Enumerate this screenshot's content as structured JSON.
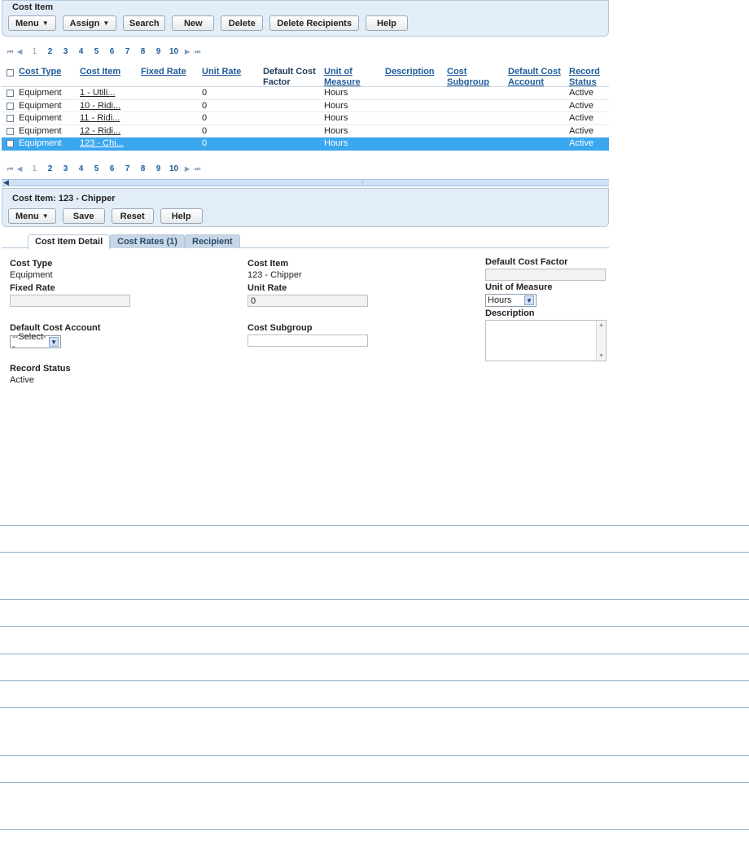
{
  "list_panel": {
    "title": "Cost Item",
    "buttons": {
      "menu": "Menu",
      "assign": "Assign",
      "search": "Search",
      "new": "New",
      "delete": "Delete",
      "delete_recipients": "Delete Recipients",
      "help": "Help"
    }
  },
  "pager": {
    "pages": [
      "1",
      "2",
      "3",
      "4",
      "5",
      "6",
      "7",
      "8",
      "9",
      "10"
    ],
    "current": "1"
  },
  "grid": {
    "columns": [
      "Cost Type",
      "Cost Item",
      "Fixed Rate",
      "Unit Rate",
      "Default Cost Factor",
      "Unit of Measure",
      "Description",
      "Cost Subgroup",
      "Default Cost Account",
      "Record Status"
    ],
    "rows": [
      {
        "cost_type": "Equipment",
        "cost_item": "1 - Utili...",
        "unit_rate": "0",
        "uom": "Hours",
        "status": "Active"
      },
      {
        "cost_type": "Equipment",
        "cost_item": "10 - Ridi...",
        "unit_rate": "0",
        "uom": "Hours",
        "status": "Active"
      },
      {
        "cost_type": "Equipment",
        "cost_item": "11 - Ridi...",
        "unit_rate": "0",
        "uom": "Hours",
        "status": "Active"
      },
      {
        "cost_type": "Equipment",
        "cost_item": "12 - Ridi...",
        "unit_rate": "0",
        "uom": "Hours",
        "status": "Active"
      },
      {
        "cost_type": "Equipment",
        "cost_item": "123 - Chi...",
        "unit_rate": "0",
        "uom": "Hours",
        "status": "Active"
      }
    ],
    "selected_row": 4
  },
  "detail_panel": {
    "title": "Cost Item: 123 - Chipper",
    "buttons": {
      "menu": "Menu",
      "save": "Save",
      "reset": "Reset",
      "help": "Help"
    }
  },
  "tabs": [
    "Cost Item Detail",
    "Cost Rates (1)",
    "Recipient"
  ],
  "form": {
    "cost_type_label": "Cost Type",
    "cost_type_value": "Equipment",
    "cost_item_label": "Cost Item",
    "cost_item_value": "123 - Chipper",
    "default_cost_factor_label": "Default Cost Factor",
    "default_cost_factor_value": "",
    "fixed_rate_label": "Fixed Rate",
    "fixed_rate_value": "",
    "unit_rate_label": "Unit Rate",
    "unit_rate_value": "0",
    "unit_of_measure_label": "Unit of Measure",
    "unit_of_measure_value": "Hours",
    "description_label": "Description",
    "default_cost_account_label": "Default Cost Account",
    "default_cost_account_value": "--Select--",
    "cost_subgroup_label": "Cost Subgroup",
    "cost_subgroup_value": "",
    "record_status_label": "Record Status",
    "record_status_value": "Active"
  }
}
